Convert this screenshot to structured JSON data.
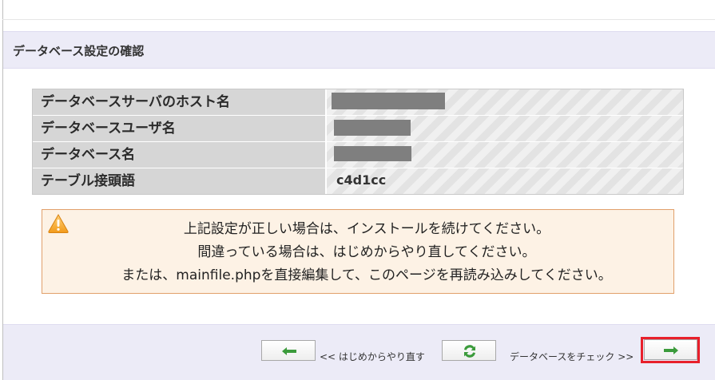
{
  "section": {
    "title": "データベース設定の確認"
  },
  "settings": {
    "rows": [
      {
        "label": "データベースサーバのホスト名",
        "value": ""
      },
      {
        "label": "データベースユーザ名",
        "value": ""
      },
      {
        "label": "データベース名",
        "value": ""
      },
      {
        "label": "テーブル接頭語",
        "value": "c4d1cc"
      }
    ]
  },
  "warning": {
    "icon": "warning-triangle-icon",
    "lines": [
      "上記設定が正しい場合は、インストールを続けてください。",
      "間違っている場合は、はじめからやり直してください。",
      "または、mainfile.phpを直接編集して、このページを再読み込みしてください。"
    ]
  },
  "nav": {
    "back_label": "<< はじめからやり直す",
    "check_label": "データベースをチェック >>",
    "back_icon": "arrow-left-icon",
    "reload_icon": "reload-icon",
    "next_icon": "arrow-right-icon"
  },
  "colors": {
    "header_bg": "#ecebf7",
    "label_bg": "#d6d6d6",
    "warning_bg": "#fdf2e5",
    "warning_border": "#e1a06b",
    "icon_green": "#3b9b3b",
    "highlight": "#e8202b"
  }
}
